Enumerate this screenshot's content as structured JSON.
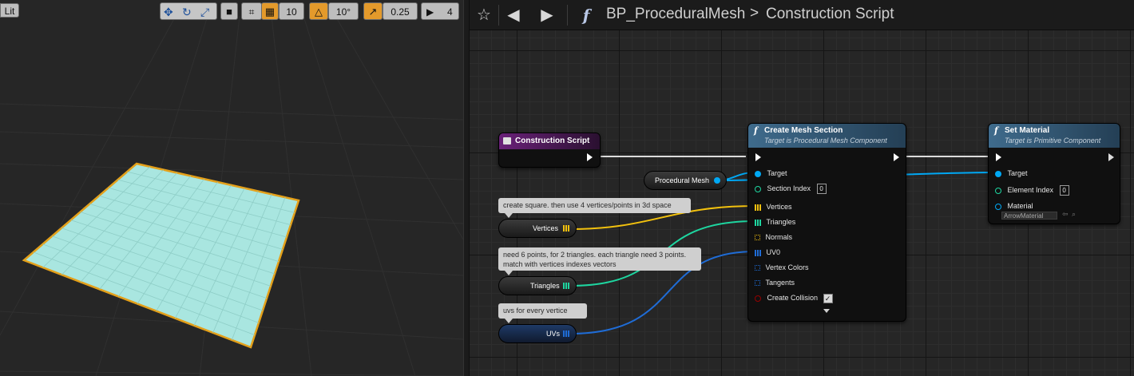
{
  "viewport": {
    "lit_label": "Lit",
    "toolbar": {
      "grid_snap_value": "10",
      "rotation_snap_value": "10°",
      "scale_snap_value": "0.25",
      "camera_speed_value": "4"
    },
    "colors": {
      "plane_fill": "#a9e6e0",
      "plane_outline": "#e4a019",
      "snap_active": "#e49a2b"
    }
  },
  "header": {
    "blueprint_name": "BP_ProceduralMesh",
    "separator": ">",
    "graph_name": "Construction Script",
    "icons": [
      "star-icon",
      "back-arrow-icon",
      "forward-arrow-icon",
      "function-icon"
    ]
  },
  "graph": {
    "construction_node": {
      "title": "Construction Script"
    },
    "create_mesh_node": {
      "title": "Create Mesh Section",
      "subtitle": "Target is Procedural Mesh Component",
      "pins": {
        "target": "Target",
        "section_index": "Section Index",
        "section_index_value": "0",
        "vertices": "Vertices",
        "triangles": "Triangles",
        "normals": "Normals",
        "uv0": "UV0",
        "vertex_colors": "Vertex Colors",
        "tangents": "Tangents",
        "create_collision": "Create Collision"
      }
    },
    "set_material_node": {
      "title": "Set Material",
      "subtitle": "Target is Primitive Component",
      "pins": {
        "target": "Target",
        "element_index": "Element Index",
        "element_index_value": "0",
        "material": "Material",
        "material_value": "ArrowMaterial"
      }
    },
    "variables": {
      "procedural_mesh": "Procedural Mesh",
      "vertices": "Vertices",
      "triangles": "Triangles",
      "uvs": "UVs"
    },
    "comments": {
      "vertices": "create square. then use 4 vertices/points in 3d space",
      "triangles_line1": "need 6 points, for 2 triangles. each triangle need 3 points.",
      "triangles_line2": "match with vertices indexes vectors",
      "uvs": "uvs for every vertice"
    },
    "colors": {
      "function_header": "#3f6b8c",
      "event_header": "#6a2179",
      "object_pin": "#00a8f4",
      "vector_pin": "#f2c10e",
      "int_pin": "#1ed6a0",
      "vector2d_pin": "#1f6cd6",
      "bool_pin": "#940000"
    }
  }
}
